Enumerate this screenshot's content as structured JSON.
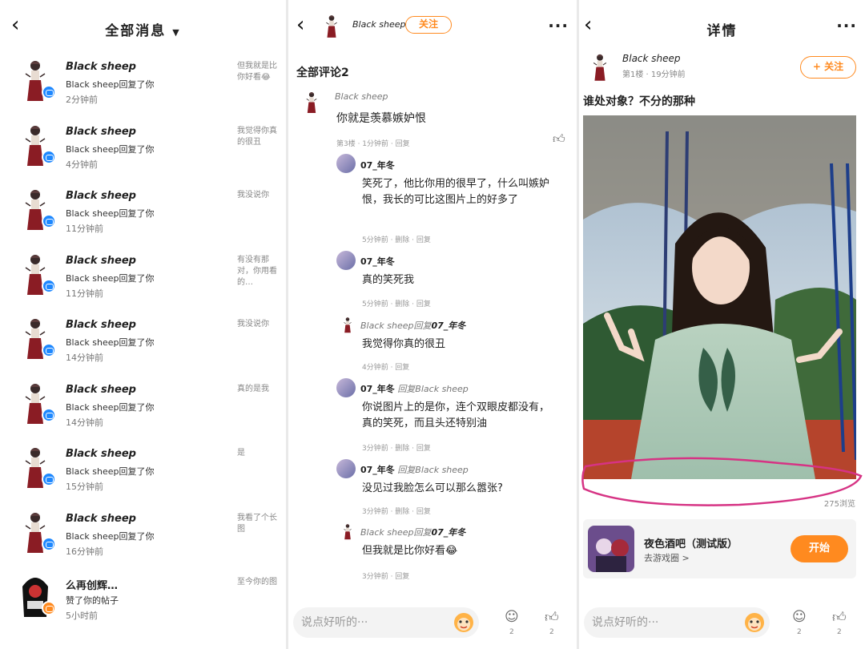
{
  "panel1": {
    "title": "全部消息",
    "messages": [
      {
        "name": "Black sheep",
        "action": "Black sheep回复了你",
        "time": "2分钟前",
        "preview": "但我就是比你好看😂"
      },
      {
        "name": "Black sheep",
        "action": "Black sheep回复了你",
        "time": "4分钟前",
        "preview": "我觉得你真的很丑"
      },
      {
        "name": "Black sheep",
        "action": "Black sheep回复了你",
        "time": "11分钟前",
        "preview": "我没说你"
      },
      {
        "name": "Black sheep",
        "action": "Black sheep回复了你",
        "time": "11分钟前",
        "preview": "有没有那对，你用看的…"
      },
      {
        "name": "Black sheep",
        "action": "Black sheep回复了你",
        "time": "14分钟前",
        "preview": "我没说你"
      },
      {
        "name": "Black sheep",
        "action": "Black sheep回复了你",
        "time": "14分钟前",
        "preview": "真的是我"
      },
      {
        "name": "Black sheep",
        "action": "Black sheep回复了你",
        "time": "15分钟前",
        "preview": "是"
      },
      {
        "name": "Black sheep",
        "action": "Black sheep回复了你",
        "time": "16分钟前",
        "preview": "我看了个长图"
      },
      {
        "name": "么再创辉…",
        "action": "赞了你的帖子",
        "time": "5小时前",
        "preview": "至今你的图"
      }
    ]
  },
  "panel2": {
    "author": "Black sheep",
    "follow": "关注",
    "section": "全部评论2",
    "comments": [
      {
        "name": "Black sheep",
        "text": "你就是羡慕嫉妒恨",
        "meta": "第3楼 · 1分钟前 · 回复"
      },
      {
        "name": "07_年冬",
        "text": "笑死了，他比你用的很早了，什么叫嫉妒恨，我长的可比这图片上的好多了",
        "meta": "5分钟前 · 删除 · 回复"
      },
      {
        "name": "07_年冬",
        "text": "真的笑死我",
        "meta": "5分钟前 · 删除 · 回复"
      },
      {
        "name": "Black sheep回复",
        "target": "07_年冬",
        "text": "我觉得你真的很丑",
        "meta": "4分钟前 · 回复"
      },
      {
        "name": "07_年冬",
        "reply": "回复Black sheep",
        "text": "你说图片上的是你，连个双眼皮都没有，真的笑死，而且头还特别油",
        "meta": "3分钟前 · 删除 · 回复"
      },
      {
        "name": "07_年冬",
        "reply": "回复Black sheep",
        "text": "没见过我脸怎么可以那么嚣张?",
        "meta": "3分钟前 · 删除 · 回复"
      },
      {
        "name": "Black sheep回复",
        "target": "07_年冬",
        "text": "但我就是比你好看😂",
        "meta": "3分钟前 · 回复"
      }
    ],
    "input_placeholder": "说点好听的···",
    "comment_count": "2",
    "like_count": "2"
  },
  "panel3": {
    "title": "详情",
    "author": "Black sheep",
    "meta": "第1楼 · 19分钟前",
    "follow": "+ 关注",
    "post_title": "谁处对象？不分的那种",
    "views": "275浏览",
    "game": {
      "name": "夜色酒吧（测试版）",
      "sub": "去游戏圈 >",
      "button": "开始"
    },
    "input_placeholder": "说点好听的···",
    "comment_count": "2",
    "like_count": "2"
  },
  "colors": {
    "accent": "#ff8a1f",
    "badge_blue": "#1e88ff",
    "annotation": "#d63384"
  },
  "icons": [
    "back-icon",
    "dropdown-icon",
    "more-icon",
    "like-icon",
    "comment-icon",
    "emoji-face-icon"
  ]
}
